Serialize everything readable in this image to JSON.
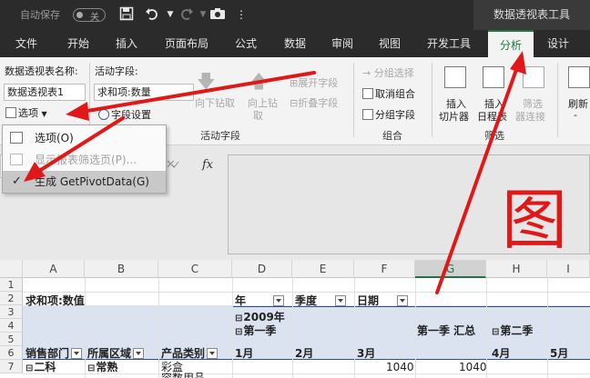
{
  "titlebar": {
    "autosave_label": "自动保存",
    "autosave_state": "关",
    "tools_title": "数据透视表工具"
  },
  "tabs": [
    {
      "label": "文件"
    },
    {
      "label": "开始"
    },
    {
      "label": "插入"
    },
    {
      "label": "页面布局"
    },
    {
      "label": "公式"
    },
    {
      "label": "数据"
    },
    {
      "label": "审阅"
    },
    {
      "label": "视图"
    },
    {
      "label": "开发工具"
    },
    {
      "label": "分析"
    },
    {
      "label": "设计"
    }
  ],
  "ribbon": {
    "pivot_name_label": "数据透视表名称:",
    "pivot_name_value": "数据透视表1",
    "options_button": "选项",
    "active_field_label": "活动字段:",
    "active_field_value": "求和项:数量",
    "field_settings": "字段设置",
    "drill_down": "向下钻取",
    "drill_up_1": "向上钻",
    "drill_up_2": "取",
    "expand_field": "展开字段",
    "collapse_field": "折叠字段",
    "active_field_group": "活动字段",
    "group_selection": "分组选择",
    "ungroup": "取消组合",
    "group_field": "分组字段",
    "group_group": "组合",
    "insert_slicer_1": "插入",
    "insert_slicer_2": "切片器",
    "insert_timeline_1": "插入",
    "insert_timeline_2": "日程表",
    "filter_conn_1": "筛选",
    "filter_conn_2": "器连接",
    "filter_group": "筛选",
    "refresh_1": "刷新",
    "refresh_2": "-"
  },
  "menu": {
    "options": "选项(O)",
    "show_filter_pages": "显示报表筛选页(P)...",
    "generate_getpivotdata": "生成 GetPivotData(G)"
  },
  "formula_bar": {
    "fx": "fx",
    "cancel": "✕",
    "enter": "✓"
  },
  "caption": "图二",
  "grid": {
    "columns": [
      "A",
      "B",
      "C",
      "D",
      "E",
      "F",
      "G",
      "H",
      "I"
    ],
    "rows": [
      "1",
      "2",
      "3",
      "4",
      "5",
      "6",
      "7"
    ],
    "cells": {
      "a3": "求和项:数值",
      "d3": "年",
      "e3": "季度",
      "f3": "日期",
      "d4": "2009年",
      "d5": "第一季",
      "g5": "第一季 汇总",
      "h5": "第二季",
      "a6": "销售部门",
      "b6": "所属区域",
      "c6": "产品类别",
      "d6": "1月",
      "e6": "2月",
      "f6": "3月",
      "h6": "4月",
      "i6": "5月",
      "a7": "二科",
      "b7": "常熟",
      "c7": "彩盒",
      "f7": "1040",
      "g7": "1040",
      "c8": "容数用品"
    }
  },
  "colors": {
    "accent": "#217346",
    "annotation": "#e01818",
    "ribbon_dark": "#2b2b2b"
  }
}
